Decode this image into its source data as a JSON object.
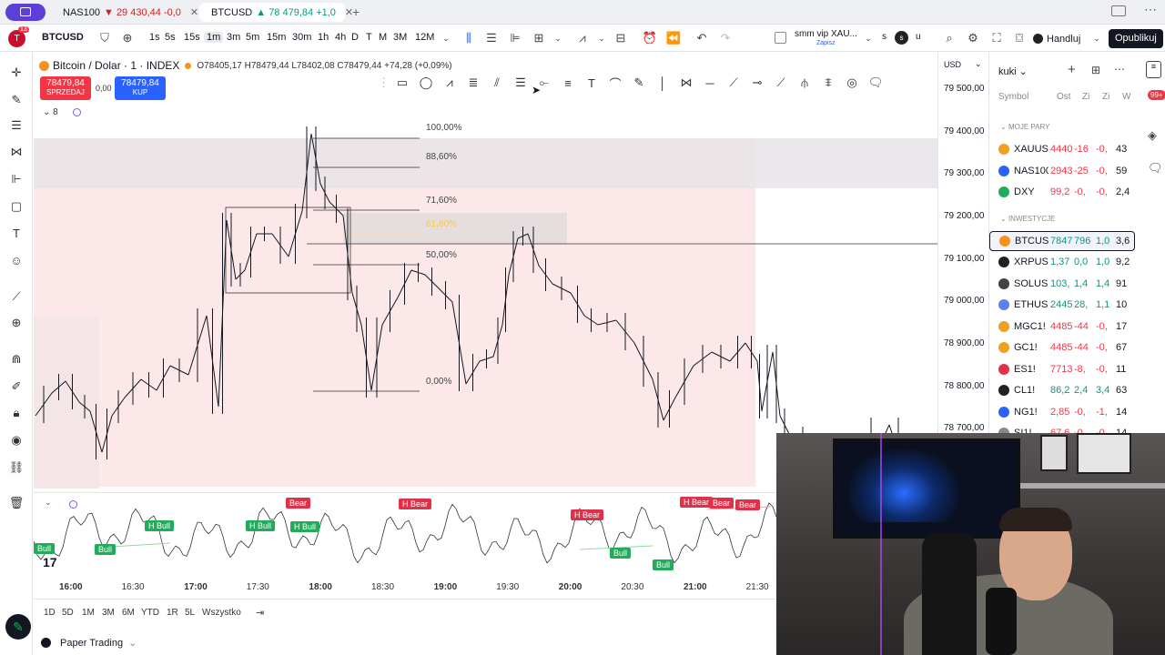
{
  "browser_tabs": [
    {
      "label": "NAS100",
      "value": "29 430,44",
      "change": "-0,0"
    },
    {
      "label": "BTCUSD",
      "value": "78 479,84",
      "change": "+1,0"
    }
  ],
  "toolbar": {
    "symbol": "BTCUSD",
    "intervals": [
      "1s",
      "5s",
      "15s",
      "1m",
      "3m",
      "5m",
      "15m",
      "30m",
      "1h",
      "4h",
      "D",
      "T",
      "M",
      "3M",
      "12M"
    ],
    "active_interval": "1m",
    "alert_name": "smm vip XAU...",
    "alert_sub": "Zapisz",
    "trade_label": "Handluj",
    "publish_label": "Opublikuj",
    "notif_count": "13",
    "s_label": "s"
  },
  "legend": {
    "title": "Bitcoin / Dolar · 1 · INDEX",
    "ohlc": "O78405,17 H78479,44 L78402,08 C78479,44 +74,28 (+0,09%)",
    "sell_price": "78479,84",
    "sell_label": "SPRZEDAJ",
    "spread": "0,00",
    "buy_price": "78479,84",
    "buy_label": "KUP",
    "indicators_count": "8"
  },
  "fib_levels": [
    "100,00%",
    "88,60%",
    "71,60%",
    "61,80%",
    "50,00%",
    "0,00%"
  ],
  "price_axis": {
    "currency": "USD",
    "labels": [
      "79 500,00",
      "79 400,00",
      "79 300,00",
      "79 200,00",
      "79 100,00",
      "79 000,00",
      "78 900,00",
      "78 800,00",
      "78 700,00"
    ]
  },
  "watchlist": {
    "name": "kuki",
    "headers": [
      "Symbol",
      "Ost",
      "Zi",
      "Zi",
      "W"
    ],
    "notif": "99+",
    "sections": [
      {
        "title": "MOJE PARY",
        "rows": [
          {
            "symbol": "XAUUSD",
            "last": "4440",
            "chg": "-16",
            "chgp": "-0,",
            "vol": "43",
            "color": "#f0a020"
          },
          {
            "symbol": "NAS100",
            "last": "2943",
            "chg": "-25",
            "chgp": "-0,",
            "vol": "59",
            "color": "#2962ff"
          },
          {
            "symbol": "DXY",
            "last": "99,2",
            "chg": "-0,",
            "chgp": "-0,",
            "vol": "2,4",
            "color": "#22ab5a"
          }
        ]
      },
      {
        "title": "INWESTYCJE",
        "rows": [
          {
            "symbol": "BTCUSD",
            "last": "7847",
            "chg": "796",
            "chgp": "1,0",
            "vol": "3,6",
            "color": "#f7931a"
          },
          {
            "symbol": "XRPUSD",
            "last": "1,37",
            "chg": "0,0",
            "chgp": "1,0",
            "vol": "9,2",
            "color": "#222222"
          },
          {
            "symbol": "SOLUSD",
            "last": "103,",
            "chg": "1,4",
            "chgp": "1,4",
            "vol": "91",
            "color": "#444444"
          },
          {
            "symbol": "ETHUSD",
            "last": "2445",
            "chg": "28,",
            "chgp": "1,1",
            "vol": "10",
            "color": "#627eea"
          },
          {
            "symbol": "MGC1!",
            "last": "4485",
            "chg": "-44",
            "chgp": "-0,",
            "vol": "17",
            "color": "#f0a020"
          },
          {
            "symbol": "GC1!",
            "last": "4485",
            "chg": "-44",
            "chgp": "-0,",
            "vol": "67",
            "color": "#f0a020"
          },
          {
            "symbol": "ES1!",
            "last": "7713",
            "chg": "-8,",
            "chgp": "-0,",
            "vol": "11",
            "color": "#e0314b"
          },
          {
            "symbol": "CL1!",
            "last": "86,2",
            "chg": "2,4",
            "chgp": "3,4",
            "vol": "63",
            "color": "#222222"
          },
          {
            "symbol": "NG1!",
            "last": "2,85",
            "chg": "-0,",
            "chgp": "-1,",
            "vol": "14",
            "color": "#2962ff"
          },
          {
            "symbol": "SI1!",
            "last": "67,6",
            "chg": "-0,",
            "chgp": "-0,",
            "vol": "14",
            "color": "#888888"
          }
        ]
      }
    ]
  },
  "oscillator_tags": [
    {
      "label": "Bull",
      "kind": "bull"
    },
    {
      "label": "Bull",
      "kind": "bull"
    },
    {
      "label": "H Bull",
      "kind": "bull"
    },
    {
      "label": "H Bull",
      "kind": "bull"
    },
    {
      "label": "Bear",
      "kind": "bear"
    },
    {
      "label": "H Bull",
      "kind": "bull"
    },
    {
      "label": "H Bear",
      "kind": "bear"
    },
    {
      "label": "H Bear",
      "kind": "bear"
    },
    {
      "label": "Bull",
      "kind": "bull"
    },
    {
      "label": "Bull",
      "kind": "bull"
    },
    {
      "label": "H Bear",
      "kind": "bear"
    },
    {
      "label": "Bear",
      "kind": "bear"
    },
    {
      "label": "Bear",
      "kind": "bear"
    }
  ],
  "time_axis": [
    "16:00",
    "16:30",
    "17:00",
    "17:30",
    "18:00",
    "18:30",
    "19:00",
    "19:30",
    "20:00",
    "20:30",
    "21:00",
    "21:30"
  ],
  "ranges": [
    "1D",
    "5D",
    "1M",
    "3M",
    "6M",
    "YTD",
    "1R",
    "5L",
    "Wszystko"
  ],
  "paper_trading": "Paper Trading",
  "colors": {
    "accent": "#2962ff",
    "sell": "#f23645",
    "buy": "#2962ff",
    "bull": "#22ab5a",
    "bear": "#e0314b"
  }
}
